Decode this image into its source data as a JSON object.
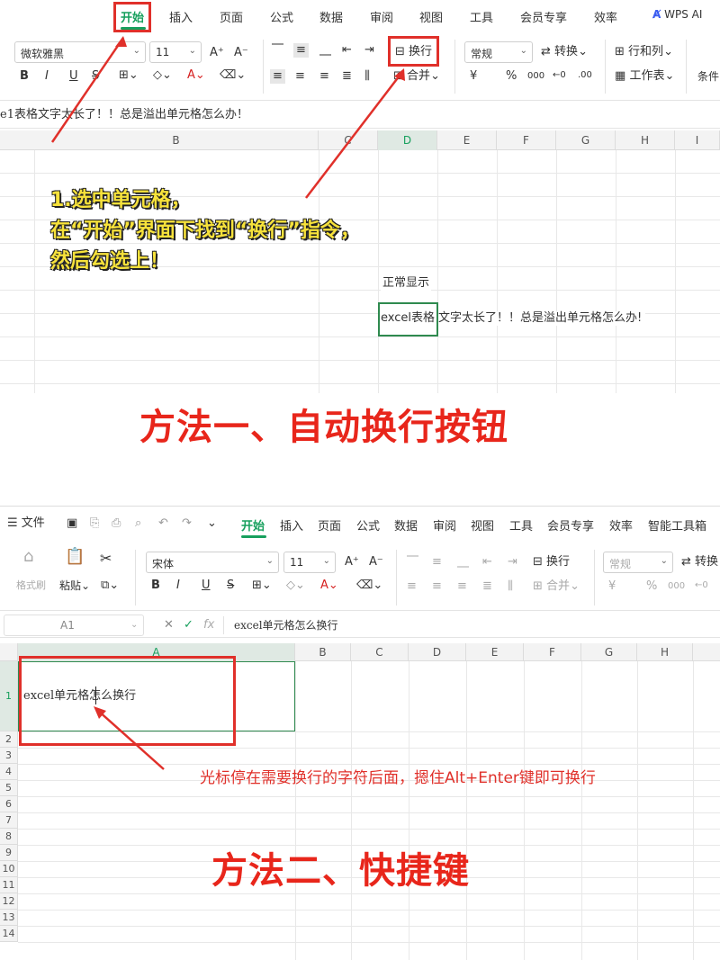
{
  "top": {
    "tabs": [
      {
        "label": "开始",
        "active": true
      },
      {
        "label": "插入"
      },
      {
        "label": "页面"
      },
      {
        "label": "公式"
      },
      {
        "label": "数据"
      },
      {
        "label": "审阅"
      },
      {
        "label": "视图"
      },
      {
        "label": "工具"
      },
      {
        "label": "会员专享"
      },
      {
        "label": "效率"
      },
      {
        "label": "WPS AI"
      }
    ],
    "ribbon": {
      "font_name": "微软雅黑",
      "font_size": "11",
      "number_format": "常规",
      "wrap_label": "换行",
      "merge_label": "合并",
      "convert_label": "转换",
      "rowcol_label": "行和列",
      "sheet_label": "工作表",
      "cond_label": "条件",
      "bold": "B",
      "italic": "I",
      "underline": "U",
      "font_grow": "A⁺",
      "font_shrink": "A⁻",
      "currency": "¥",
      "percent": "%",
      "thousands": "000"
    },
    "formula_text": "e1表格文字太长了！！总是溢出单元格怎么办！",
    "columns": [
      "B",
      "C",
      "D",
      "E",
      "F",
      "G",
      "H",
      "I"
    ],
    "note_lines": [
      "1.选中单元格，",
      "在“开始”界面下找到“换行”指令，",
      "然后勾选上！"
    ],
    "cell_label": "正常显示",
    "cell_content_boxed": "excel表格",
    "cell_content_overflow": "文字太长了！！总是溢出单元格怎么办!",
    "method_title": "方法一、自动换行按钮"
  },
  "bottom": {
    "menu": {
      "file_label": "文件",
      "tabs": [
        {
          "label": "开始",
          "active": true
        },
        {
          "label": "插入"
        },
        {
          "label": "页面"
        },
        {
          "label": "公式"
        },
        {
          "label": "数据"
        },
        {
          "label": "审阅"
        },
        {
          "label": "视图"
        },
        {
          "label": "工具"
        },
        {
          "label": "会员专享"
        },
        {
          "label": "效率"
        },
        {
          "label": "智能工具箱"
        }
      ]
    },
    "ribbon": {
      "format_painter": "格式刷",
      "paste": "粘贴",
      "font_name": "宋体",
      "font_size": "11",
      "wrap_label": "换行",
      "merge_label": "合并",
      "number_format": "常规",
      "convert_label": "转换",
      "bold": "B",
      "italic": "I",
      "underline": "U",
      "strike": "S",
      "font_grow": "A⁺",
      "font_shrink": "A⁻",
      "currency": "¥",
      "percent": "%",
      "thousands": "000"
    },
    "namebox": "A1",
    "fx": "fx",
    "formula_text": "excel单元格怎么换行",
    "columns": [
      "A",
      "B",
      "C",
      "D",
      "E",
      "F",
      "G",
      "H"
    ],
    "rows": [
      "1",
      "2",
      "3",
      "4",
      "5",
      "6",
      "7",
      "8",
      "9",
      "10",
      "11",
      "12",
      "13",
      "14"
    ],
    "cell_a1": "excel单元格怎么换行",
    "caption": "光标停在需要换行的字符后面，摁住Alt+Enter键即可换行",
    "method_title": "方法二、快捷键"
  },
  "colors": {
    "accent_green": "#17a05d",
    "annotation_red": "#e0302a",
    "title_red": "#e8261b",
    "note_yellow": "#f7e23b"
  }
}
